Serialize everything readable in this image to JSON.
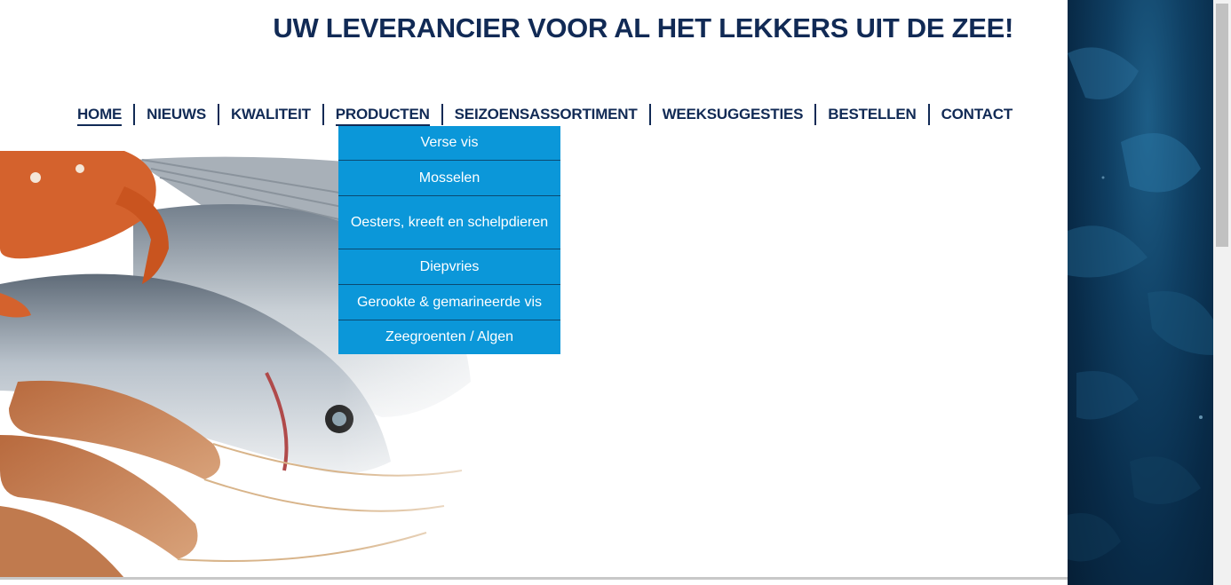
{
  "header": {
    "tagline": "UW LEVERANCIER VOOR AL HET LEKKERS UIT DE ZEE!"
  },
  "nav": {
    "items": [
      {
        "label": "HOME",
        "active": true
      },
      {
        "label": "NIEUWS"
      },
      {
        "label": "KWALITEIT"
      },
      {
        "label": "PRODUCTEN"
      },
      {
        "label": "SEIZOENSASSORTIMENT"
      },
      {
        "label": "WEEKSUGGESTIES"
      },
      {
        "label": "BESTELLEN"
      },
      {
        "label": "CONTACT"
      }
    ]
  },
  "dropdown": {
    "items": [
      {
        "label": "Verse vis"
      },
      {
        "label": "Mosselen"
      },
      {
        "label": "Oesters, kreeft en schelpdieren"
      },
      {
        "label": "Diepvries"
      },
      {
        "label": "Gerookte & gemarineerde vis"
      },
      {
        "label": "Zeegroenten / Algen"
      }
    ]
  },
  "colors": {
    "brand_navy": "#112a55",
    "dropdown_blue": "#0b97d9",
    "ocean_dark": "#082a47"
  },
  "icons": {
    "hero": "seafood-photo",
    "side": "ocean-background"
  }
}
